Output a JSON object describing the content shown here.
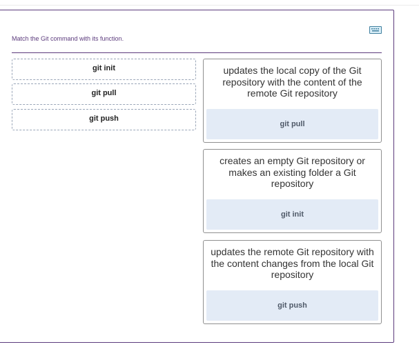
{
  "instructions": "Match the Git command with its function.",
  "icons": {
    "keyboard": "keyboard-icon"
  },
  "colors": {
    "accent": "#5b3a7c",
    "drop_zone": "#e3ebf6"
  },
  "sources": [
    {
      "label": "git init"
    },
    {
      "label": "git pull"
    },
    {
      "label": "git push"
    }
  ],
  "targets": [
    {
      "description": "updates the local copy of the Git repository with the content of the remote Git repository",
      "answer": "git pull"
    },
    {
      "description": "creates an empty Git repository or makes an existing folder a Git repository",
      "answer": "git init"
    },
    {
      "description": "updates the remote Git repository with the content changes from the local Git repository",
      "answer": "git push"
    }
  ]
}
